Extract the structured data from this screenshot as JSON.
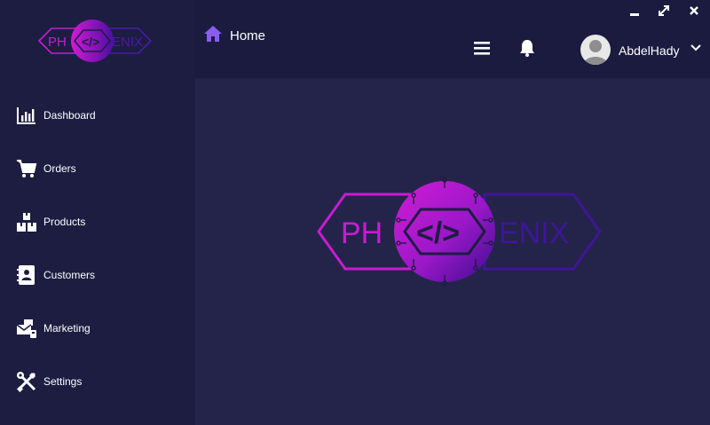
{
  "brand": {
    "logo_prefix": "PH",
    "logo_code": "</>",
    "logo_suffix": "ENIX"
  },
  "sidebar": {
    "items": [
      {
        "label": "Dashboard",
        "icon": "bar-chart-icon"
      },
      {
        "label": "Orders",
        "icon": "cart-icon"
      },
      {
        "label": "Products",
        "icon": "boxes-icon"
      },
      {
        "label": "Customers",
        "icon": "contact-book-icon"
      },
      {
        "label": "Marketing",
        "icon": "megaphone-icon"
      },
      {
        "label": "Settings",
        "icon": "tools-icon"
      }
    ]
  },
  "header": {
    "breadcrumb": "Home",
    "user": {
      "name": "AbdelHady"
    }
  },
  "window_controls": [
    "minimize",
    "maximize",
    "close"
  ],
  "colors": {
    "sidebar_bg": "#1d1d42",
    "topbar_bg": "#1b1b40",
    "main_bg": "#24244a",
    "accent_magenta": "#c21bd0",
    "accent_purple": "#5a10b0",
    "home_icon": "#8a5cf0"
  }
}
